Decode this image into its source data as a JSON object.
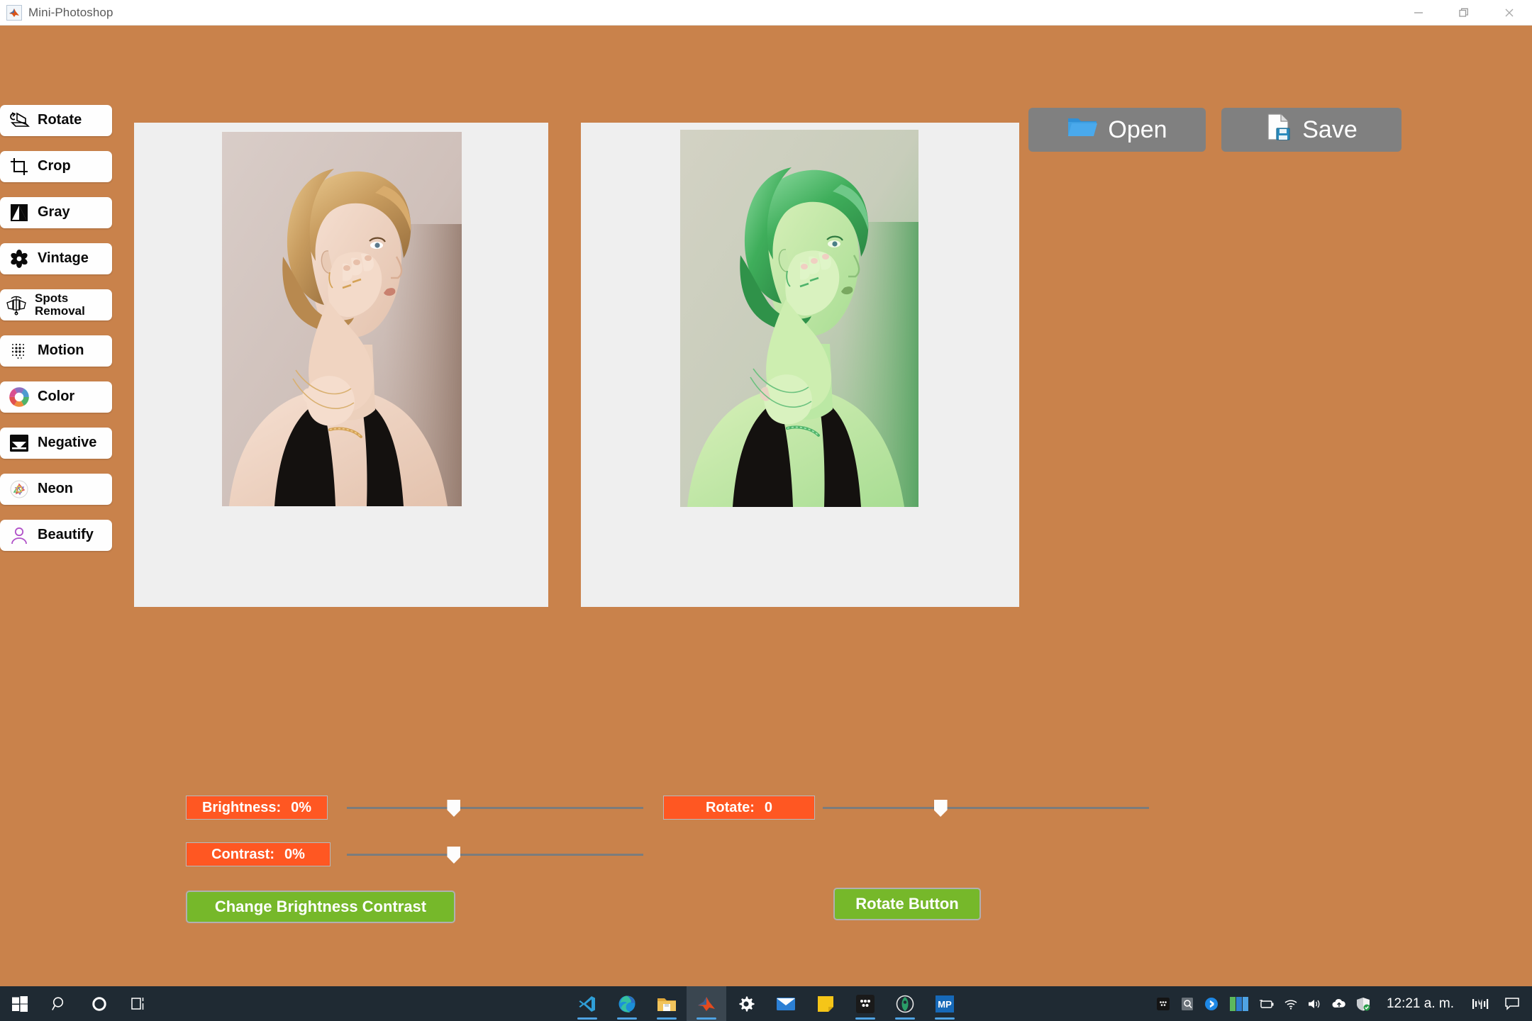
{
  "window": {
    "title": "Mini-Photoshop",
    "app_icon": "matlab-icon",
    "controls": {
      "minimize": "minimize-icon",
      "restore": "restore-icon",
      "close": "close-icon"
    },
    "background_color": "#C9824B"
  },
  "sidebar": {
    "items": [
      {
        "label": "Rotate",
        "icon": "rotate-3d-icon",
        "two_line": false
      },
      {
        "label": "Crop",
        "icon": "crop-icon",
        "two_line": false
      },
      {
        "label": "Gray",
        "icon": "grayscale-icon",
        "two_line": false
      },
      {
        "label": "Vintage",
        "icon": "flower-icon",
        "two_line": false
      },
      {
        "label": "Spots\nRemoval",
        "icon": "spots-removal-icon",
        "two_line": true
      },
      {
        "label": "Motion",
        "icon": "motion-dots-icon",
        "two_line": false
      },
      {
        "label": "Color",
        "icon": "color-wheel-icon",
        "two_line": false
      },
      {
        "label": "Negative",
        "icon": "negative-icon",
        "two_line": false
      },
      {
        "label": "Neon",
        "icon": "neon-icon",
        "two_line": false
      },
      {
        "label": "Beautify",
        "icon": "person-icon",
        "two_line": false
      }
    ]
  },
  "toolbar": {
    "open_label": "Open",
    "open_icon": "folder-icon",
    "save_label": "Save",
    "save_icon": "save-document-icon",
    "button_color": "#808080"
  },
  "panels": {
    "original": {
      "name": "original-image",
      "alt": "portrait of woman with blonde bob hair, hand on cheek, black top"
    },
    "edited": {
      "name": "edited-image",
      "alt": "same portrait with green color filter applied"
    }
  },
  "controls": {
    "label_color": "#FF5722",
    "button_color": "#76B82A",
    "brightness": {
      "label": "Brightness:",
      "value": "0%",
      "thumb_percent": 36,
      "min": -100,
      "max": 100
    },
    "contrast": {
      "label": "Contrast:",
      "value": "0%",
      "thumb_percent": 36,
      "min": -100,
      "max": 100
    },
    "rotate": {
      "label": "Rotate:",
      "value": "0",
      "thumb_percent": 36,
      "min": -180,
      "max": 180
    },
    "change_bc_button": "Change Brightness Contrast",
    "rotate_button": "Rotate Button"
  },
  "taskbar": {
    "start": "windows-start-icon",
    "search": "search-icon",
    "cortana": "cortana-icon",
    "taskview": "task-view-icon",
    "apps": [
      {
        "name": "vscode-icon",
        "active": false,
        "running": true
      },
      {
        "name": "edge-icon",
        "active": false,
        "running": true
      },
      {
        "name": "file-explorer-icon",
        "active": false,
        "running": true
      },
      {
        "name": "matlab-icon",
        "active": true,
        "running": true
      },
      {
        "name": "settings-icon",
        "active": false,
        "running": false
      },
      {
        "name": "mail-icon",
        "active": false,
        "running": false
      },
      {
        "name": "sticky-notes-icon",
        "active": false,
        "running": false
      },
      {
        "name": "flowchart-icon",
        "active": false,
        "running": true
      },
      {
        "name": "gitkraken-icon",
        "active": false,
        "running": true
      },
      {
        "name": "mp-app-icon",
        "active": false,
        "running": true
      }
    ],
    "tray": [
      "flowchart-tray-icon",
      "onedrive-search-icon",
      "bluetooth-icon",
      "green-blue-tiles-icon",
      "battery-icon",
      "wifi-icon",
      "volume-icon",
      "cloud-upload-icon",
      "defender-shield-icon"
    ],
    "clock": "12:21 a. m.",
    "meet_icon": "meet-now-icon",
    "notifications": "notification-icon"
  }
}
